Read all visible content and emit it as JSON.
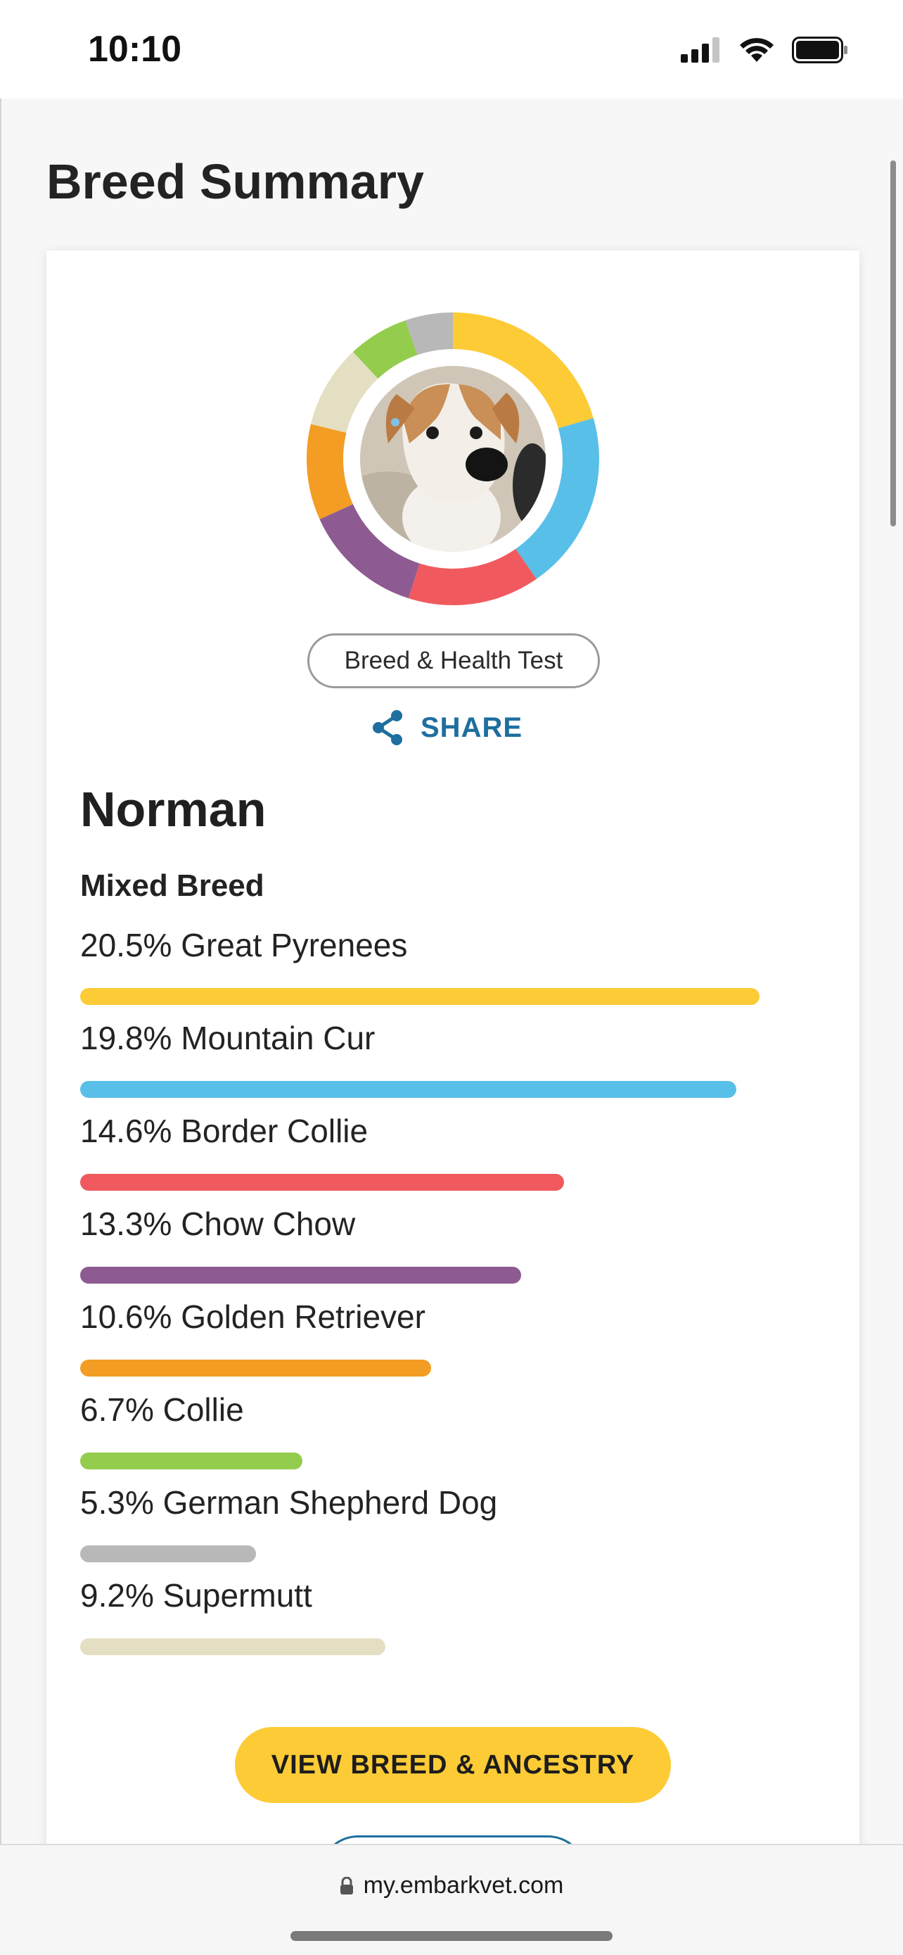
{
  "status_bar": {
    "time": "10:10"
  },
  "page": {
    "title": "Breed Summary"
  },
  "profile": {
    "test_type": "Breed & Health Test",
    "share_label": "SHARE",
    "dog_name": "Norman",
    "breed_type": "Mixed Breed"
  },
  "chart_data": {
    "type": "bar",
    "categories": [
      "Great Pyrenees",
      "Mountain Cur",
      "Border Collie",
      "Chow Chow",
      "Golden Retriever",
      "Collie",
      "German Shepherd Dog",
      "Supermutt"
    ],
    "values": [
      20.5,
      19.8,
      14.6,
      13.3,
      10.6,
      6.7,
      5.3,
      9.2
    ],
    "colors": [
      "#fdcb36",
      "#58bfe8",
      "#f05a5f",
      "#8d5b92",
      "#f39d24",
      "#94cc4e",
      "#b8b8b8",
      "#e4dfc3"
    ]
  },
  "breeds": [
    {
      "label": "20.5% Great Pyrenees"
    },
    {
      "label": "19.8% Mountain Cur"
    },
    {
      "label": "14.6% Border Collie"
    },
    {
      "label": "13.3% Chow Chow"
    },
    {
      "label": "10.6% Golden Retriever"
    },
    {
      "label": "6.7% Collie"
    },
    {
      "label": "5.3% German Shepherd Dog"
    },
    {
      "label": "9.2% Supermutt"
    }
  ],
  "actions": {
    "primary": "VIEW BREED & ANCESTRY"
  },
  "browser": {
    "url": "my.embarkvet.com"
  },
  "icons": {
    "share": "share-icon",
    "lock": "lock-icon",
    "signal": "cellular-signal-icon",
    "wifi": "wifi-icon",
    "battery": "battery-icon"
  }
}
